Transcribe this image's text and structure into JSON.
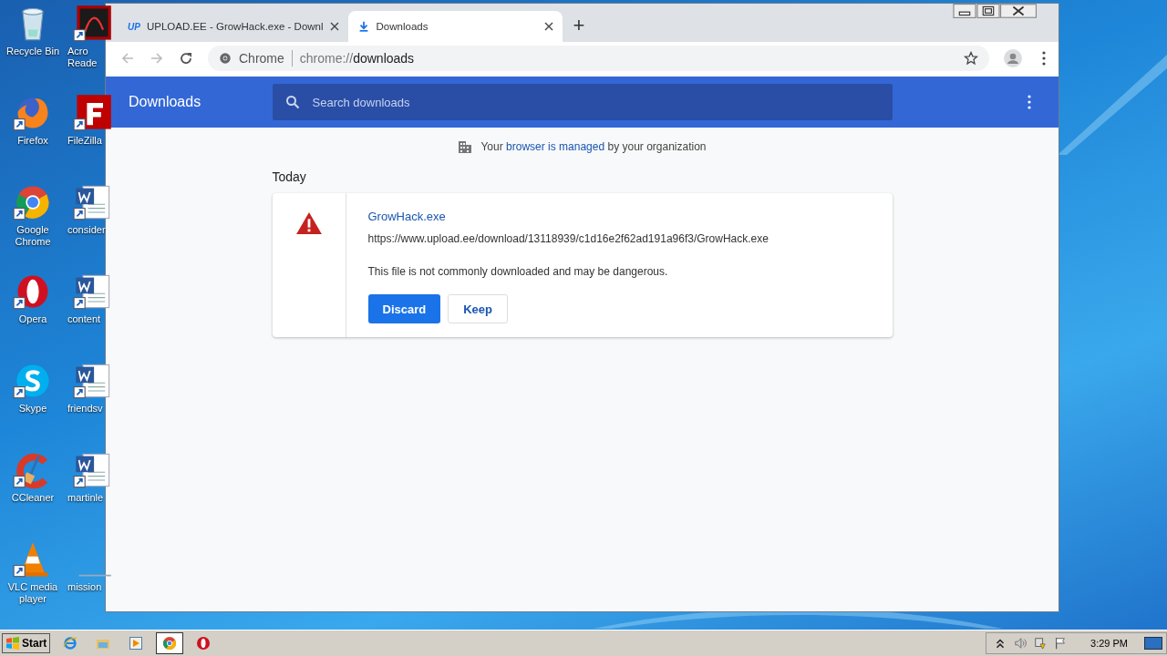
{
  "desktop": {
    "icons": [
      {
        "label": "Recycle Bin",
        "kind": "recycle"
      },
      {
        "label": "Acro Reade",
        "kind": "pdf"
      },
      {
        "label": "Firefox",
        "kind": "firefox"
      },
      {
        "label": "FileZilla",
        "kind": "filezilla"
      },
      {
        "label": "Google Chrome",
        "kind": "chrome"
      },
      {
        "label": "consider",
        "kind": "word"
      },
      {
        "label": "Opera",
        "kind": "opera"
      },
      {
        "label": "content",
        "kind": "word"
      },
      {
        "label": "Skype",
        "kind": "skype"
      },
      {
        "label": "friendsv",
        "kind": "word"
      },
      {
        "label": "CCleaner",
        "kind": "ccleaner"
      },
      {
        "label": "martinle",
        "kind": "word"
      },
      {
        "label": "VLC media player",
        "kind": "vlc"
      },
      {
        "label": "mission",
        "kind": "blank"
      }
    ]
  },
  "browser": {
    "tabs": [
      {
        "title": "UPLOAD.EE - GrowHack.exe - Downl",
        "icon": "UP",
        "kind": "site",
        "selected": false
      },
      {
        "title": "Downloads",
        "kind": "download",
        "selected": true
      }
    ],
    "new_tab": "+",
    "address": {
      "label": "Chrome",
      "scheme": "chrome://",
      "path": "downloads"
    },
    "page": {
      "title": "Downloads",
      "search_placeholder": "Search downloads",
      "managed": {
        "before": "Your",
        "link": "browser is managed",
        "after": "by your organization"
      },
      "section": "Today",
      "item": {
        "filename": "GrowHack.exe",
        "url": "https://www.upload.ee/download/13118939/c1d16e2f62ad191a96f3/GrowHack.exe",
        "warning": "This file is not commonly downloaded and may be dangerous.",
        "buttons": [
          {
            "label": "Discard",
            "kind": "primary"
          },
          {
            "label": "Keep",
            "kind": "secondary"
          }
        ]
      }
    }
  },
  "taskbar": {
    "start": "Start",
    "items": [
      {
        "kind": "ie",
        "selected": false
      },
      {
        "kind": "explorer",
        "selected": false
      },
      {
        "kind": "media",
        "selected": false
      },
      {
        "kind": "chrome",
        "selected": true
      },
      {
        "kind": "opera",
        "selected": false
      }
    ],
    "time": "3:29 PM"
  }
}
